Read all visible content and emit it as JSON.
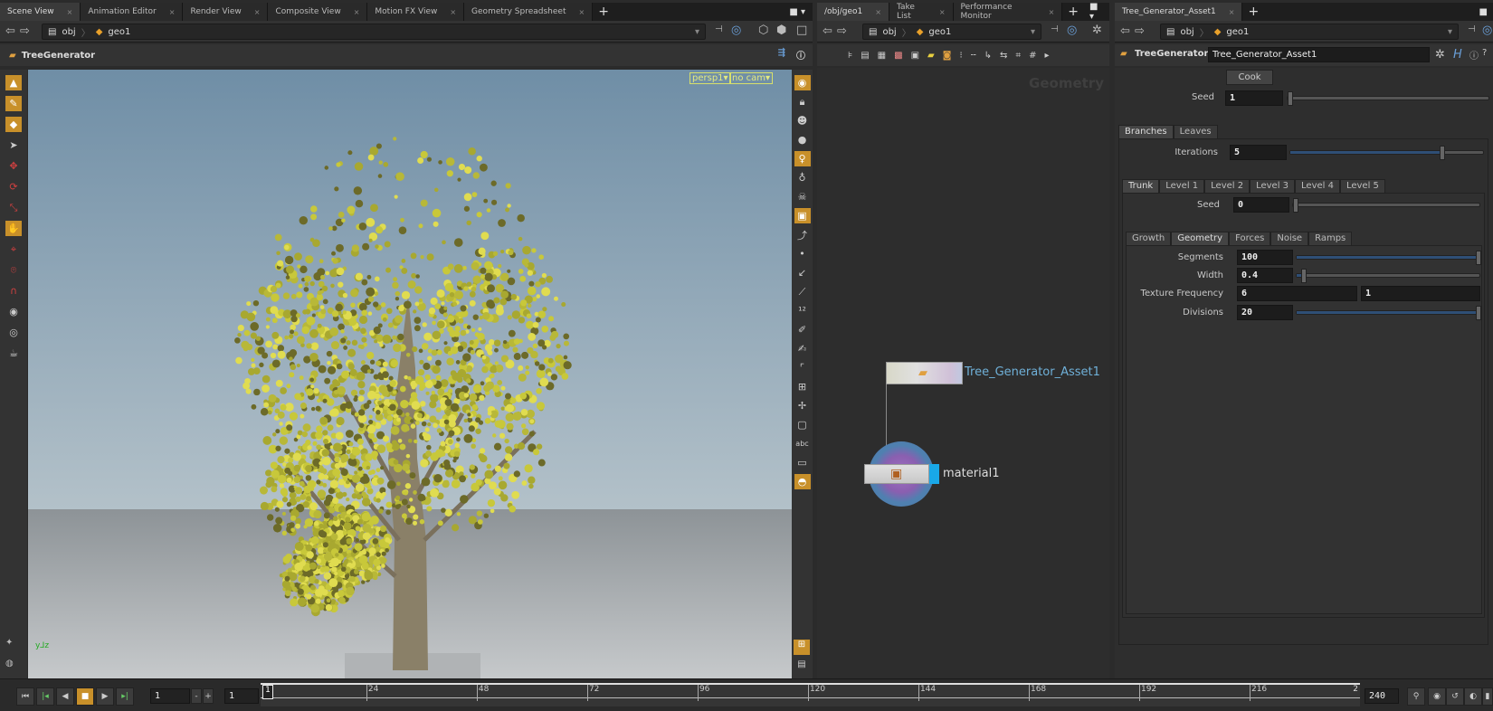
{
  "scene_panel": {
    "tabs": [
      {
        "label": "Scene View",
        "active": true
      },
      {
        "label": "Animation Editor"
      },
      {
        "label": "Render View"
      },
      {
        "label": "Composite View"
      },
      {
        "label": "Motion FX View"
      },
      {
        "label": "Geometry Spreadsheet"
      }
    ],
    "path": [
      "obj",
      "geo1"
    ],
    "header_title": "TreeGenerator",
    "camera_menu": "persp1▾",
    "cam_menu": "no cam▾"
  },
  "network_panel": {
    "tabs": [
      {
        "label": "/obj/geo1",
        "active": true
      },
      {
        "label": "Take List"
      },
      {
        "label": "Performance Monitor"
      }
    ],
    "path": [
      "obj",
      "geo1"
    ],
    "context_watermark": "Geometry",
    "nodes": [
      {
        "name": "Tree_Generator_Asset1",
        "color": "#6fb0d8"
      },
      {
        "name": "material1",
        "color": "#dddddd"
      }
    ]
  },
  "param_panel": {
    "tabs": [
      {
        "label": "Tree_Generator_Asset1",
        "active": true
      }
    ],
    "path": [
      "obj",
      "geo1"
    ],
    "node_type": "TreeGenerator",
    "node_name": "Tree_Generator_Asset1",
    "cook_label": "Cook",
    "seed": {
      "label": "Seed",
      "value": "1",
      "fraction": 0.0
    },
    "main_tabs": [
      "Branches",
      "Leaves"
    ],
    "iterations": {
      "label": "Iterations",
      "value": "5",
      "fraction": 0.78
    },
    "level_tabs": [
      "Trunk",
      "Level 1",
      "Level 2",
      "Level 3",
      "Level 4",
      "Level 5"
    ],
    "level_seed": {
      "label": "Seed",
      "value": "0",
      "fraction": 0.0
    },
    "sub_tabs": [
      "Growth",
      "Geometry",
      "Forces",
      "Noise",
      "Ramps"
    ],
    "segments": {
      "label": "Segments",
      "value": "100",
      "fraction": 1.0
    },
    "width": {
      "label": "Width",
      "value": "0.4",
      "fraction": 0.04
    },
    "texture_frequency": {
      "label": "Texture Frequency",
      "value1": "6",
      "value2": "1"
    },
    "divisions": {
      "label": "Divisions",
      "value": "20",
      "fraction": 1.0
    }
  },
  "timeline": {
    "current_frame": "1",
    "start_frame": "1",
    "end_frame": "240",
    "ticks": [
      "24",
      "48",
      "72",
      "96",
      "120",
      "144",
      "168",
      "192",
      "216"
    ],
    "frame_marker": "1",
    "end_marker": "2"
  },
  "colors": {
    "accent": "#c8902a",
    "viewport_sky": "#7c98ad",
    "viewport_ground": "#9aa0a4",
    "leaves": "#c8c83a"
  }
}
